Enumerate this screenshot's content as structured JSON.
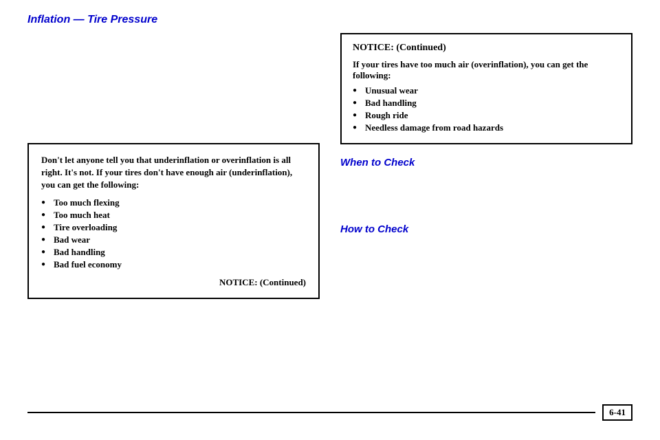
{
  "page": {
    "title": "Inflation — Tire Pressure",
    "page_number": "6-41"
  },
  "left_column": {
    "underinflation_box": {
      "intro": "Don't let anyone tell you that underinflation or overinflation is all right. It's not. If your tires don't have enough air (underinflation), you can get the following:",
      "items": [
        "Too much flexing",
        "Too much heat",
        "Tire overloading",
        "Bad wear",
        "Bad handling",
        "Bad fuel economy"
      ],
      "notice_continued": "NOTICE: (Continued)"
    }
  },
  "right_column": {
    "overinflation_box": {
      "title": "NOTICE: (Continued)",
      "intro": "If your tires have too much air (overinflation), you can get the following:",
      "items": [
        "Unusual wear",
        "Bad handling",
        "Rough ride",
        "Needless damage from road hazards"
      ]
    },
    "when_to_check": {
      "heading": "When to Check"
    },
    "how_to_check": {
      "heading": "How to Check"
    }
  }
}
